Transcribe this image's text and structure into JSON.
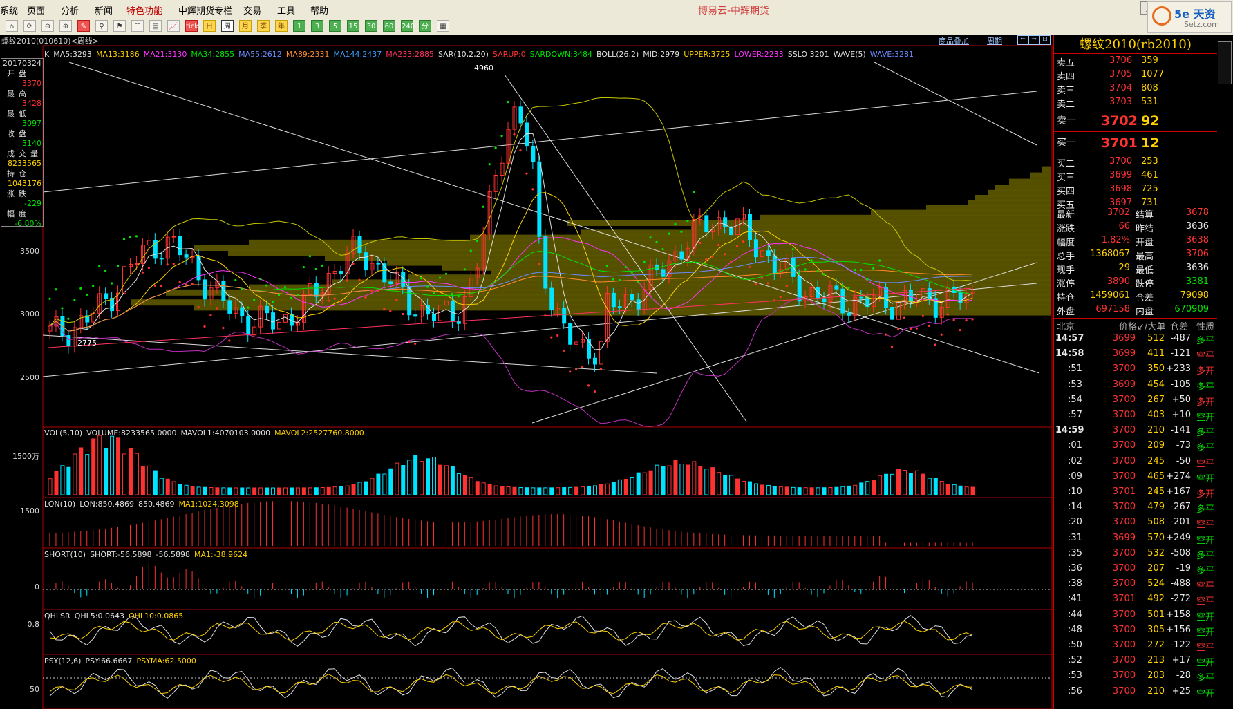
{
  "menu": [
    "系统",
    "页面",
    "分析",
    "新闻",
    "特色功能",
    "中辉期货专栏",
    "交易",
    "工具",
    "帮助"
  ],
  "window_title": "博易云-中辉期货",
  "toolbar_buttons": [
    "⌂",
    "⟳",
    "⊖",
    "⊕",
    "✎",
    "⚲",
    "⚑",
    "☷",
    "▤",
    "📈",
    "tick",
    "日",
    "周",
    "月",
    "季",
    "年",
    "1",
    "3",
    "5",
    "15",
    "30",
    "60",
    "240",
    "分钟",
    "▦"
  ],
  "chart_header": {
    "instrument": "螺纹2010(010610)<周线>",
    "link1": "商品叠加",
    "link2": "周期"
  },
  "info_box": {
    "date": "20170324",
    "items": [
      {
        "label": "开盘",
        "value": "3370",
        "color": "#ff3232"
      },
      {
        "label": "最高",
        "value": "3428",
        "color": "#ff3232"
      },
      {
        "label": "最低",
        "value": "3097",
        "color": "#00e400"
      },
      {
        "label": "收盘",
        "value": "3140",
        "color": "#00e400"
      },
      {
        "label": "成交量",
        "value": "8233565",
        "color": "#ffd200"
      },
      {
        "label": "持仓",
        "value": "1043176",
        "color": "#ffd200"
      },
      {
        "label": "涨跌",
        "value": "-229",
        "color": "#00e400"
      },
      {
        "label": "幅度",
        "value": "-6.80%",
        "color": "#00e400"
      }
    ]
  },
  "main_legend": [
    {
      "text": "K",
      "color": "#e0e0e0"
    },
    {
      "text": "MA5:3293",
      "color": "#e0e0e0"
    },
    {
      "text": "MA13:3186",
      "color": "#ffd200"
    },
    {
      "text": "MA21:3130",
      "color": "#ff33ff"
    },
    {
      "text": "MA34:2855",
      "color": "#00e400"
    },
    {
      "text": "MA55:2612",
      "color": "#6b8cff"
    },
    {
      "text": "MA89:2331",
      "color": "#ff8a2a"
    },
    {
      "text": "MA144:2437",
      "color": "#3aa0ff"
    },
    {
      "text": "MA233:2885",
      "color": "#ff3260"
    },
    {
      "text": "SAR(10,2,20)",
      "color": "#e0e0e0"
    },
    {
      "text": "SARUP:0",
      "color": "#ff3232"
    },
    {
      "text": "SARDOWN:3484",
      "color": "#00e400"
    },
    {
      "text": "BOLL(26,2)",
      "color": "#e0e0e0"
    },
    {
      "text": "MID:2979",
      "color": "#e0e0e0"
    },
    {
      "text": "UPPER:3725",
      "color": "#ffd200"
    },
    {
      "text": "LOWER:2233",
      "color": "#ff33ff"
    },
    {
      "text": "SSLO 3201",
      "color": "#e0e0e0"
    },
    {
      "text": "WAVE(5)",
      "color": "#e0e0e0"
    },
    {
      "text": "WAVE:3281",
      "color": "#6b8cff"
    }
  ],
  "main_axis": [
    "3500",
    "3000",
    "2500"
  ],
  "main_annotations": {
    "high": "4960",
    "low": "2775"
  },
  "vol_panel": {
    "legend": [
      {
        "text": "VOL(5,10)",
        "color": "#e0e0e0"
      },
      {
        "text": "VOLUME:8233565.0000",
        "color": "#e0e0e0"
      },
      {
        "text": "MAVOL1:4070103.0000",
        "color": "#e0e0e0"
      },
      {
        "text": "MAVOL2:2527760.8000",
        "color": "#ffd200"
      }
    ],
    "axis": "1500万"
  },
  "lon_panel": {
    "legend": [
      {
        "text": "LON(10)",
        "color": "#e0e0e0"
      },
      {
        "text": "LON:850.4869",
        "color": "#e0e0e0"
      },
      {
        "text": "850.4869",
        "color": "#e0e0e0"
      },
      {
        "text": "MA1:1024.3098",
        "color": "#ffd200"
      }
    ],
    "axis": "1500"
  },
  "short_panel": {
    "legend": [
      {
        "text": "SHORT(10)",
        "color": "#e0e0e0"
      },
      {
        "text": "SHORT:-56.5898",
        "color": "#e0e0e0"
      },
      {
        "text": "-56.5898",
        "color": "#e0e0e0"
      },
      {
        "text": "MA1:-38.9624",
        "color": "#ffd200"
      }
    ],
    "axis": "0"
  },
  "qhlsr_panel": {
    "legend": [
      {
        "text": "QHLSR",
        "color": "#e0e0e0"
      },
      {
        "text": "QHL5:0.0643",
        "color": "#e0e0e0"
      },
      {
        "text": "QHL10:0.0865",
        "color": "#ffd200"
      }
    ],
    "axis": "0.8"
  },
  "psy_panel": {
    "legend": [
      {
        "text": "PSY(12,6)",
        "color": "#e0e0e0"
      },
      {
        "text": "PSY:66.6667",
        "color": "#e0e0e0"
      },
      {
        "text": "PSYMA:62.5000",
        "color": "#ffd200"
      }
    ],
    "axis": "50"
  },
  "right_panel": {
    "title": "螺纹2010(rb2010)",
    "asks": [
      {
        "label": "卖五",
        "price": "3706",
        "vol": "359"
      },
      {
        "label": "卖四",
        "price": "3705",
        "vol": "1077"
      },
      {
        "label": "卖三",
        "price": "3704",
        "vol": "808"
      },
      {
        "label": "卖二",
        "price": "3703",
        "vol": "531"
      },
      {
        "label": "卖一",
        "price": "3702",
        "vol": "92"
      }
    ],
    "bids": [
      {
        "label": "买一",
        "price": "3701",
        "vol": "12"
      },
      {
        "label": "买二",
        "price": "3700",
        "vol": "253"
      },
      {
        "label": "买三",
        "price": "3699",
        "vol": "461"
      },
      {
        "label": "买四",
        "price": "3698",
        "vol": "725"
      },
      {
        "label": "买五",
        "price": "3697",
        "vol": "731"
      }
    ],
    "stats": [
      {
        "l1": "最新",
        "v1": "3702",
        "c1": "#ff3232",
        "l2": "结算",
        "v2": "3678",
        "c2": "#ff3232"
      },
      {
        "l1": "涨跌",
        "v1": "66",
        "c1": "#ff3232",
        "l2": "昨结",
        "v2": "3636",
        "c2": "#e8e8e8"
      },
      {
        "l1": "幅度",
        "v1": "1.82%",
        "c1": "#ff3232",
        "l2": "开盘",
        "v2": "3638",
        "c2": "#ff3232"
      },
      {
        "l1": "总手",
        "v1": "1368067",
        "c1": "#ffd200",
        "l2": "最高",
        "v2": "3706",
        "c2": "#ff3232"
      },
      {
        "l1": "现手",
        "v1": "29",
        "c1": "#ffd200",
        "l2": "最低",
        "v2": "3636",
        "c2": "#e8e8e8"
      },
      {
        "l1": "涨停",
        "v1": "3890",
        "c1": "#ff3232",
        "l2": "跌停",
        "v2": "3381",
        "c2": "#00e400"
      },
      {
        "l1": "持仓",
        "v1": "1459061",
        "c1": "#ffd200",
        "l2": "仓差",
        "v2": "79098",
        "c2": "#ffd200"
      },
      {
        "l1": "外盘",
        "v1": "697158",
        "c1": "#ff3232",
        "l2": "内盘",
        "v2": "670909",
        "c2": "#00e400"
      }
    ],
    "tick_header": {
      "time": "北京",
      "price": "价格",
      "vol": "↙/大单",
      "oi": "仓差",
      "nature": "性质"
    },
    "ticks": [
      {
        "t": "14:57",
        "p": "3699",
        "v": "512",
        "oi": "-487",
        "n": "多平",
        "nc": "#00e400"
      },
      {
        "t": "14:58",
        "p": "3699",
        "v": "411",
        "oi": "-121",
        "n": "空平",
        "nc": "#ff3232"
      },
      {
        "t": ":51",
        "p": "3700",
        "v": "350",
        "oi": "+233",
        "n": "多开",
        "nc": "#ff3232"
      },
      {
        "t": ":53",
        "p": "3699",
        "v": "454",
        "oi": "-105",
        "n": "多平",
        "nc": "#00e400"
      },
      {
        "t": ":54",
        "p": "3700",
        "v": "267",
        "oi": "+50",
        "n": "多开",
        "nc": "#ff3232"
      },
      {
        "t": ":57",
        "p": "3700",
        "v": "403",
        "oi": "+10",
        "n": "空开",
        "nc": "#00e400"
      },
      {
        "t": "14:59",
        "p": "3700",
        "v": "210",
        "oi": "-141",
        "n": "多平",
        "nc": "#00e400"
      },
      {
        "t": ":01",
        "p": "3700",
        "v": "209",
        "oi": "-73",
        "n": "多平",
        "nc": "#00e400"
      },
      {
        "t": ":02",
        "p": "3700",
        "v": "245",
        "oi": "-50",
        "n": "空平",
        "nc": "#ff3232"
      },
      {
        "t": ":09",
        "p": "3700",
        "v": "465",
        "oi": "+274",
        "n": "空开",
        "nc": "#00e400"
      },
      {
        "t": ":10",
        "p": "3701",
        "v": "245",
        "oi": "+167",
        "n": "多开",
        "nc": "#ff3232"
      },
      {
        "t": ":14",
        "p": "3700",
        "v": "479",
        "oi": "-267",
        "n": "多平",
        "nc": "#00e400"
      },
      {
        "t": ":20",
        "p": "3700",
        "v": "508",
        "oi": "-201",
        "n": "空平",
        "nc": "#ff3232"
      },
      {
        "t": ":31",
        "p": "3699",
        "v": "570",
        "oi": "+249",
        "n": "空开",
        "nc": "#00e400"
      },
      {
        "t": ":35",
        "p": "3700",
        "v": "532",
        "oi": "-508",
        "n": "多平",
        "nc": "#00e400"
      },
      {
        "t": ":36",
        "p": "3700",
        "v": "207",
        "oi": "-19",
        "n": "多平",
        "nc": "#00e400"
      },
      {
        "t": ":38",
        "p": "3700",
        "v": "524",
        "oi": "-488",
        "n": "空平",
        "nc": "#ff3232"
      },
      {
        "t": ":41",
        "p": "3701",
        "v": "492",
        "oi": "-272",
        "n": "空平",
        "nc": "#ff3232"
      },
      {
        "t": ":44",
        "p": "3700",
        "v": "501",
        "oi": "+158",
        "n": "空开",
        "nc": "#00e400"
      },
      {
        "t": ":48",
        "p": "3700",
        "v": "305",
        "oi": "+156",
        "n": "空开",
        "nc": "#00e400"
      },
      {
        "t": ":50",
        "p": "3700",
        "v": "272",
        "oi": "-122",
        "n": "空平",
        "nc": "#ff3232"
      },
      {
        "t": ":52",
        "p": "3700",
        "v": "213",
        "oi": "+17",
        "n": "空开",
        "nc": "#00e400"
      },
      {
        "t": ":53",
        "p": "3700",
        "v": "203",
        "oi": "-28",
        "n": "多平",
        "nc": "#00e400"
      },
      {
        "t": ":56",
        "p": "3700",
        "v": "210",
        "oi": "+25",
        "n": "空开",
        "nc": "#00e400"
      }
    ]
  },
  "logo": {
    "text": "5e 天资",
    "sub": "Setz.com"
  }
}
